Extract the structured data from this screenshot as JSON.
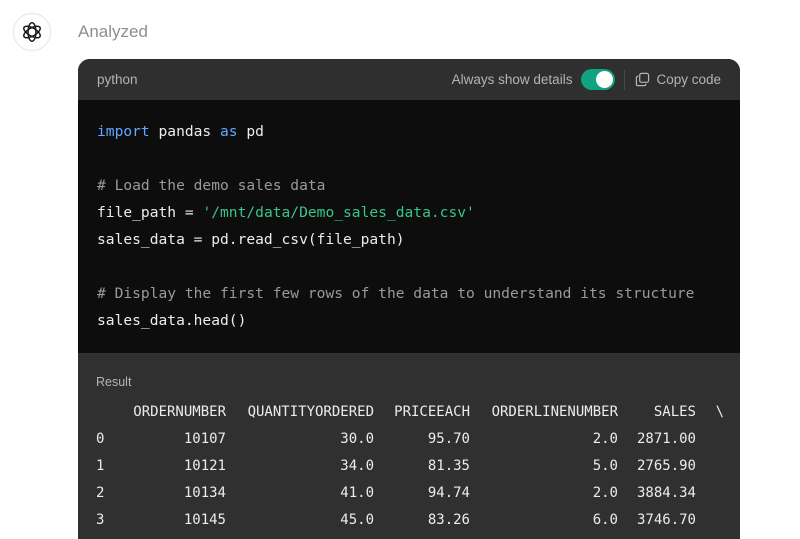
{
  "message": {
    "status": "Analyzed"
  },
  "code_block": {
    "language": "python",
    "always_show_details_label": "Always show details",
    "always_show_details_enabled": true,
    "copy_label": "Copy code",
    "lines": [
      {
        "parts": [
          {
            "t": "kw",
            "v": "import"
          },
          {
            "t": "plain",
            "v": " pandas "
          },
          {
            "t": "kw",
            "v": "as"
          },
          {
            "t": "plain",
            "v": " pd"
          }
        ]
      },
      {
        "parts": []
      },
      {
        "parts": [
          {
            "t": "cm",
            "v": "# Load the demo sales data"
          }
        ]
      },
      {
        "parts": [
          {
            "t": "plain",
            "v": "file_path = "
          },
          {
            "t": "str",
            "v": "'/mnt/data/Demo_sales_data.csv'"
          }
        ]
      },
      {
        "parts": [
          {
            "t": "plain",
            "v": "sales_data = pd.read_csv(file_path)"
          }
        ]
      },
      {
        "parts": []
      },
      {
        "parts": [
          {
            "t": "cm",
            "v": "# Display the first few rows of the data to understand its structure"
          }
        ]
      },
      {
        "parts": [
          {
            "t": "plain",
            "v": "sales_data.head()"
          }
        ]
      }
    ]
  },
  "result": {
    "label": "Result",
    "columns": [
      "",
      "ORDERNUMBER",
      "QUANTITYORDERED",
      "PRICEEACH",
      "ORDERLINENUMBER",
      "SALES",
      "\\"
    ],
    "rows": [
      [
        "0",
        "10107",
        "30.0",
        "95.70",
        "2.0",
        "2871.00",
        ""
      ],
      [
        "1",
        "10121",
        "34.0",
        "81.35",
        "5.0",
        "2765.90",
        ""
      ],
      [
        "2",
        "10134",
        "41.0",
        "94.74",
        "2.0",
        "3884.34",
        ""
      ],
      [
        "3",
        "10145",
        "45.0",
        "83.26",
        "6.0",
        "3746.70",
        ""
      ]
    ]
  },
  "icons": {
    "avatar": "openai-logo-icon",
    "copy": "copy-icon"
  },
  "colors": {
    "toggle_on": "#10a37f",
    "keyword": "#5fa8ff",
    "string": "#37c58a",
    "comment": "#9a9a9a"
  }
}
